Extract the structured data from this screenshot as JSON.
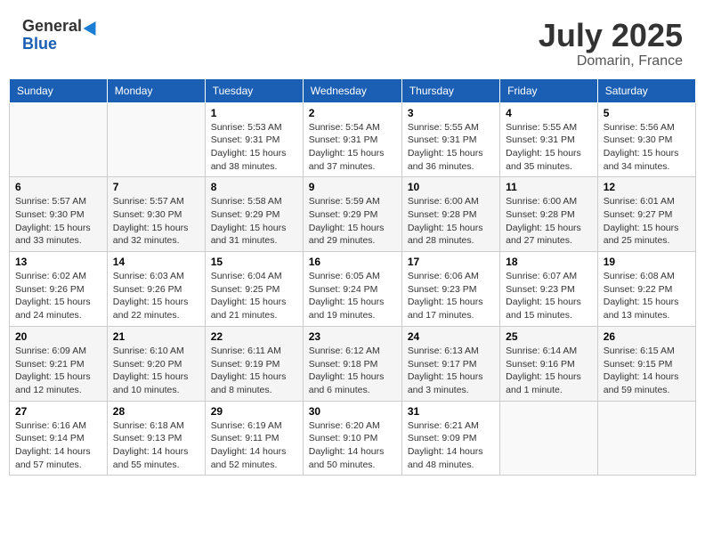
{
  "header": {
    "logo_general": "General",
    "logo_blue": "Blue",
    "month_title": "July 2025",
    "location": "Domarin, France"
  },
  "weekdays": [
    "Sunday",
    "Monday",
    "Tuesday",
    "Wednesday",
    "Thursday",
    "Friday",
    "Saturday"
  ],
  "weeks": [
    [
      {
        "day": "",
        "sunrise": "",
        "sunset": "",
        "daylight": ""
      },
      {
        "day": "",
        "sunrise": "",
        "sunset": "",
        "daylight": ""
      },
      {
        "day": "1",
        "sunrise": "Sunrise: 5:53 AM",
        "sunset": "Sunset: 9:31 PM",
        "daylight": "Daylight: 15 hours and 38 minutes."
      },
      {
        "day": "2",
        "sunrise": "Sunrise: 5:54 AM",
        "sunset": "Sunset: 9:31 PM",
        "daylight": "Daylight: 15 hours and 37 minutes."
      },
      {
        "day": "3",
        "sunrise": "Sunrise: 5:55 AM",
        "sunset": "Sunset: 9:31 PM",
        "daylight": "Daylight: 15 hours and 36 minutes."
      },
      {
        "day": "4",
        "sunrise": "Sunrise: 5:55 AM",
        "sunset": "Sunset: 9:31 PM",
        "daylight": "Daylight: 15 hours and 35 minutes."
      },
      {
        "day": "5",
        "sunrise": "Sunrise: 5:56 AM",
        "sunset": "Sunset: 9:30 PM",
        "daylight": "Daylight: 15 hours and 34 minutes."
      }
    ],
    [
      {
        "day": "6",
        "sunrise": "Sunrise: 5:57 AM",
        "sunset": "Sunset: 9:30 PM",
        "daylight": "Daylight: 15 hours and 33 minutes."
      },
      {
        "day": "7",
        "sunrise": "Sunrise: 5:57 AM",
        "sunset": "Sunset: 9:30 PM",
        "daylight": "Daylight: 15 hours and 32 minutes."
      },
      {
        "day": "8",
        "sunrise": "Sunrise: 5:58 AM",
        "sunset": "Sunset: 9:29 PM",
        "daylight": "Daylight: 15 hours and 31 minutes."
      },
      {
        "day": "9",
        "sunrise": "Sunrise: 5:59 AM",
        "sunset": "Sunset: 9:29 PM",
        "daylight": "Daylight: 15 hours and 29 minutes."
      },
      {
        "day": "10",
        "sunrise": "Sunrise: 6:00 AM",
        "sunset": "Sunset: 9:28 PM",
        "daylight": "Daylight: 15 hours and 28 minutes."
      },
      {
        "day": "11",
        "sunrise": "Sunrise: 6:00 AM",
        "sunset": "Sunset: 9:28 PM",
        "daylight": "Daylight: 15 hours and 27 minutes."
      },
      {
        "day": "12",
        "sunrise": "Sunrise: 6:01 AM",
        "sunset": "Sunset: 9:27 PM",
        "daylight": "Daylight: 15 hours and 25 minutes."
      }
    ],
    [
      {
        "day": "13",
        "sunrise": "Sunrise: 6:02 AM",
        "sunset": "Sunset: 9:26 PM",
        "daylight": "Daylight: 15 hours and 24 minutes."
      },
      {
        "day": "14",
        "sunrise": "Sunrise: 6:03 AM",
        "sunset": "Sunset: 9:26 PM",
        "daylight": "Daylight: 15 hours and 22 minutes."
      },
      {
        "day": "15",
        "sunrise": "Sunrise: 6:04 AM",
        "sunset": "Sunset: 9:25 PM",
        "daylight": "Daylight: 15 hours and 21 minutes."
      },
      {
        "day": "16",
        "sunrise": "Sunrise: 6:05 AM",
        "sunset": "Sunset: 9:24 PM",
        "daylight": "Daylight: 15 hours and 19 minutes."
      },
      {
        "day": "17",
        "sunrise": "Sunrise: 6:06 AM",
        "sunset": "Sunset: 9:23 PM",
        "daylight": "Daylight: 15 hours and 17 minutes."
      },
      {
        "day": "18",
        "sunrise": "Sunrise: 6:07 AM",
        "sunset": "Sunset: 9:23 PM",
        "daylight": "Daylight: 15 hours and 15 minutes."
      },
      {
        "day": "19",
        "sunrise": "Sunrise: 6:08 AM",
        "sunset": "Sunset: 9:22 PM",
        "daylight": "Daylight: 15 hours and 13 minutes."
      }
    ],
    [
      {
        "day": "20",
        "sunrise": "Sunrise: 6:09 AM",
        "sunset": "Sunset: 9:21 PM",
        "daylight": "Daylight: 15 hours and 12 minutes."
      },
      {
        "day": "21",
        "sunrise": "Sunrise: 6:10 AM",
        "sunset": "Sunset: 9:20 PM",
        "daylight": "Daylight: 15 hours and 10 minutes."
      },
      {
        "day": "22",
        "sunrise": "Sunrise: 6:11 AM",
        "sunset": "Sunset: 9:19 PM",
        "daylight": "Daylight: 15 hours and 8 minutes."
      },
      {
        "day": "23",
        "sunrise": "Sunrise: 6:12 AM",
        "sunset": "Sunset: 9:18 PM",
        "daylight": "Daylight: 15 hours and 6 minutes."
      },
      {
        "day": "24",
        "sunrise": "Sunrise: 6:13 AM",
        "sunset": "Sunset: 9:17 PM",
        "daylight": "Daylight: 15 hours and 3 minutes."
      },
      {
        "day": "25",
        "sunrise": "Sunrise: 6:14 AM",
        "sunset": "Sunset: 9:16 PM",
        "daylight": "Daylight: 15 hours and 1 minute."
      },
      {
        "day": "26",
        "sunrise": "Sunrise: 6:15 AM",
        "sunset": "Sunset: 9:15 PM",
        "daylight": "Daylight: 14 hours and 59 minutes."
      }
    ],
    [
      {
        "day": "27",
        "sunrise": "Sunrise: 6:16 AM",
        "sunset": "Sunset: 9:14 PM",
        "daylight": "Daylight: 14 hours and 57 minutes."
      },
      {
        "day": "28",
        "sunrise": "Sunrise: 6:18 AM",
        "sunset": "Sunset: 9:13 PM",
        "daylight": "Daylight: 14 hours and 55 minutes."
      },
      {
        "day": "29",
        "sunrise": "Sunrise: 6:19 AM",
        "sunset": "Sunset: 9:11 PM",
        "daylight": "Daylight: 14 hours and 52 minutes."
      },
      {
        "day": "30",
        "sunrise": "Sunrise: 6:20 AM",
        "sunset": "Sunset: 9:10 PM",
        "daylight": "Daylight: 14 hours and 50 minutes."
      },
      {
        "day": "31",
        "sunrise": "Sunrise: 6:21 AM",
        "sunset": "Sunset: 9:09 PM",
        "daylight": "Daylight: 14 hours and 48 minutes."
      },
      {
        "day": "",
        "sunrise": "",
        "sunset": "",
        "daylight": ""
      },
      {
        "day": "",
        "sunrise": "",
        "sunset": "",
        "daylight": ""
      }
    ]
  ]
}
